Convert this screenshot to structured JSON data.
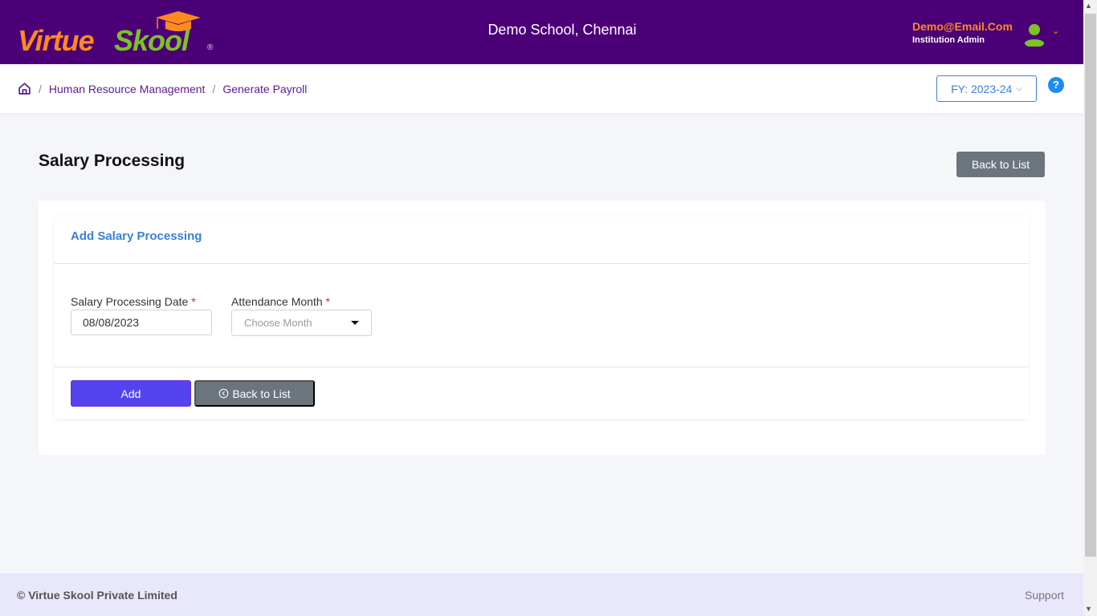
{
  "header": {
    "logo_part1": "Virtue",
    "logo_part2": "Skool",
    "logo_reg": "®",
    "school_name": "Demo School, Chennai",
    "user_email": "Demo@Email.Com",
    "user_role": "Institution Admin",
    "colors": {
      "bg": "#4b0078",
      "orange": "#ff8a1e",
      "green": "#7dc224"
    }
  },
  "breadcrumb": {
    "home_icon": "home-icon",
    "items": [
      "Human Resource Management",
      "Generate Payroll"
    ],
    "separator": "/"
  },
  "fy_selector": {
    "label": "FY: 2023-24"
  },
  "help": {
    "label": "?"
  },
  "page": {
    "title": "Salary Processing",
    "back_button": "Back to List"
  },
  "form": {
    "card_title": "Add Salary Processing",
    "fields": [
      {
        "label": "Salary Processing Date",
        "required": "*",
        "value": "08/08/2023"
      },
      {
        "label": "Attendance Month",
        "required": "*",
        "placeholder": "Choose Month"
      }
    ],
    "add_button": "Add",
    "back_button": "Back to List"
  },
  "footer": {
    "copyright": "© Virtue Skool Private Limited",
    "support": "Support"
  }
}
